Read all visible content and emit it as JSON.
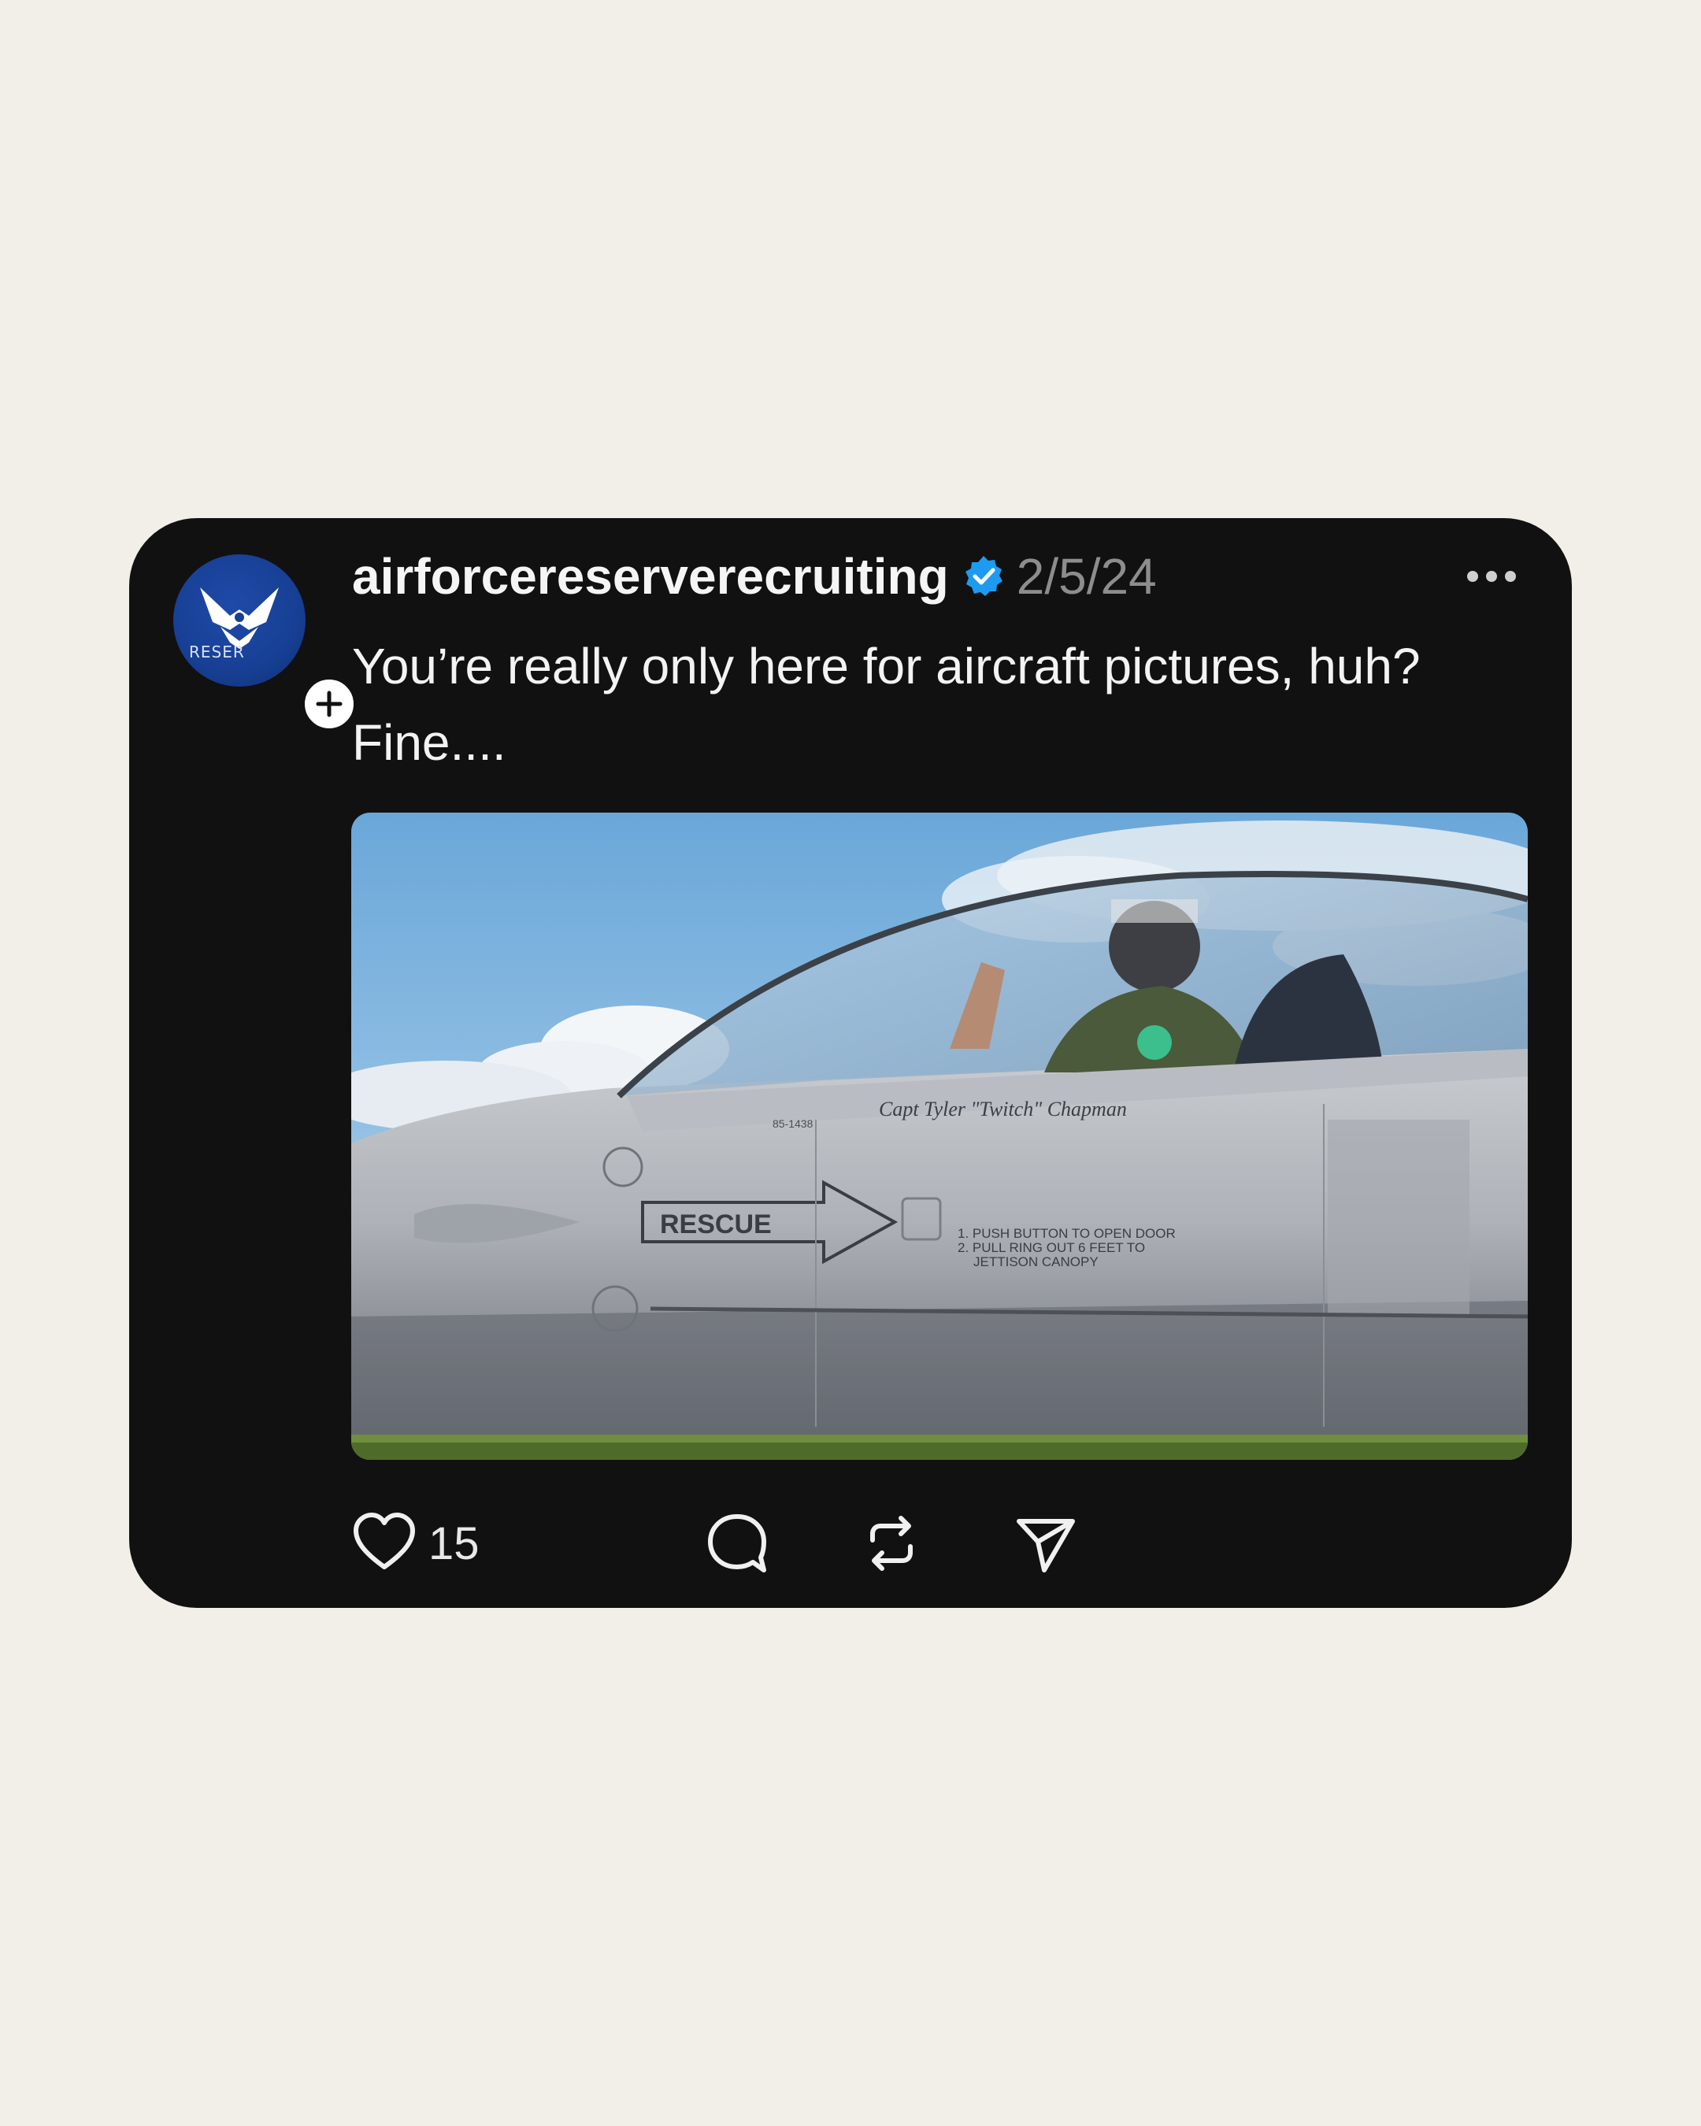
{
  "post": {
    "username": "airforcereserverecruiting",
    "verified": true,
    "date": "2/5/24",
    "caption": "You’re really only here for aircraft pictures, huh? Fine....",
    "avatar": {
      "icon": "air-force-wings-logo",
      "text": "RESER"
    },
    "follow_icon": "plus-icon",
    "more_icon": "ellipsis-icon",
    "media": {
      "description_marks": {
        "rescue_label": "RESCUE",
        "nameplate": "Capt Tyler \"Twitch\" Chapman",
        "serial": "85-1438",
        "instructions": [
          "1. PUSH BUTTON TO OPEN DOOR",
          "2. PULL RING OUT 6 FEET TO",
          "JETTISON CANOPY"
        ]
      }
    },
    "actions": {
      "like_icon": "heart-icon",
      "like_count": "15",
      "comment_icon": "comment-bubble-icon",
      "repost_icon": "repost-icon",
      "share_icon": "send-icon"
    }
  },
  "colors": {
    "page_background": "#f2efe9",
    "card_background": "#111111",
    "verified_blue": "#1d9bf0",
    "date_gray": "#8d8d8d"
  }
}
